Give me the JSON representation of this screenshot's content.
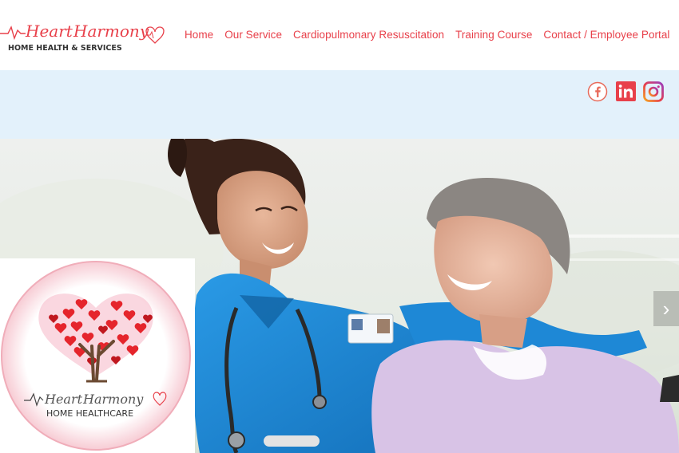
{
  "brand": {
    "top_line_left": "Heart",
    "top_line_right": "Harmony",
    "bottom_line": "HOME HEALTH & SERVICES",
    "card_top_left": "Heart",
    "card_top_right": "Harmony",
    "card_bottom_line": "HOME HEALTHCARE"
  },
  "nav": {
    "items": [
      {
        "label": "Home"
      },
      {
        "label": "Our Service"
      },
      {
        "label": "Cardiopulmonary Resuscitation"
      },
      {
        "label": "Training Course"
      },
      {
        "label": "Contact / Employee Portal"
      }
    ]
  },
  "social": {
    "icons": [
      "facebook-icon",
      "linkedin-icon",
      "instagram-icon"
    ]
  },
  "colors": {
    "accent": "#e8404a",
    "band": "#e3f1fb",
    "nurse_scrubs": "#1e88d6",
    "patient_sweater": "#d8c3e6"
  },
  "hero": {
    "prev_arrow": "‹",
    "next_arrow": "›"
  }
}
